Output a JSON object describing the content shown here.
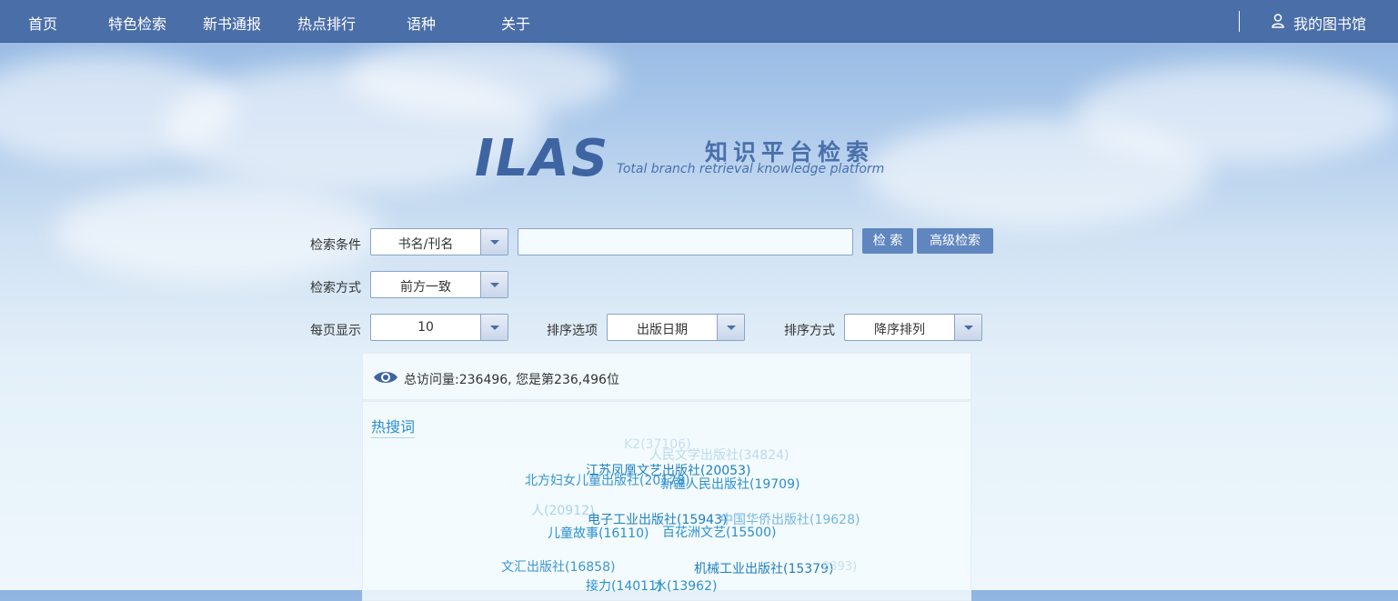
{
  "nav": {
    "items": [
      "首页",
      "特色检索",
      "新书通报",
      "热点排行",
      "语种",
      "关于"
    ],
    "my_library": "我的图书馆"
  },
  "logo": {
    "brand": "ILAS",
    "title_cn": "知识平台检索",
    "subtitle_en": "Total branch retrieval knowledge platform"
  },
  "search": {
    "condition_label": "检索条件",
    "condition_value": "书名/刊名",
    "query_value": "",
    "search_button": "检 索",
    "advanced_button": "高级检索",
    "mode_label": "检索方式",
    "mode_value": "前方一致",
    "per_page_label": "每页显示",
    "per_page_value": "10",
    "sort_option_label": "排序选项",
    "sort_option_value": "出版日期",
    "sort_order_label": "排序方式",
    "sort_order_value": "降序排列"
  },
  "visits": {
    "text": "总访问量:236496, 您是第236,496位"
  },
  "hot": {
    "title": "热搜词",
    "tags": [
      {
        "text": "K2(37106)",
        "color": "#c8dff0",
        "weight": "normal"
      },
      {
        "text": "人民文学出版社(34824)",
        "color": "#bcd9ee",
        "weight": "normal"
      },
      {
        "text": "江苏凤凰文艺出版社(20053)",
        "color": "#1f7fc0",
        "weight": "normal"
      },
      {
        "text": "北方妇女儿童出版社(20178)",
        "color": "#3793cf",
        "weight": "normal"
      },
      {
        "text": "新疆人民出版社(19709)",
        "color": "#2a8fd0",
        "weight": "normal"
      },
      {
        "text": "人(20912)",
        "color": "#a9d2ec",
        "weight": "normal"
      },
      {
        "text": "电子工业出版社(15943)",
        "color": "#1f7fc0",
        "weight": "normal"
      },
      {
        "text": "中国华侨出版社(19628)",
        "color": "#75b6e0",
        "weight": "normal"
      },
      {
        "text": "儿童故事(16110)",
        "color": "#2a8fd0",
        "weight": "normal"
      },
      {
        "text": "百花洲文艺(15500)",
        "color": "#2a8fd0",
        "weight": "normal"
      },
      {
        "text": "文汇出版社(16858)",
        "color": "#3b96d1",
        "weight": "normal"
      },
      {
        "text": "机械工业出版社(15379)",
        "color": "#1f7fc0",
        "weight": "normal"
      },
      {
        "text": "8393)",
        "color": "#c8dff0",
        "weight": "normal"
      },
      {
        "text": "接力(14011)",
        "color": "#2a8fd0",
        "weight": "normal"
      },
      {
        "text": "水(13962)",
        "color": "#2a8fd0",
        "weight": "normal"
      }
    ]
  }
}
